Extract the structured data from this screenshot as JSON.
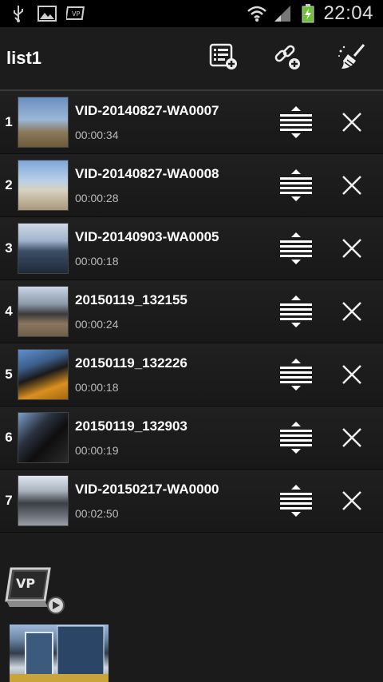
{
  "status_bar": {
    "time": "22:04",
    "icons": [
      "usb-icon",
      "image-icon",
      "vp-notification-icon",
      "wifi-icon",
      "signal-icon",
      "battery-charging-icon"
    ]
  },
  "header": {
    "title": "list1",
    "actions": [
      "add-list-icon",
      "add-link-icon",
      "clear-broom-icon"
    ]
  },
  "items": [
    {
      "index": "1",
      "name": "VID-20140827-WA0007",
      "duration": "00:00:34"
    },
    {
      "index": "2",
      "name": "VID-20140827-WA0008",
      "duration": "00:00:28"
    },
    {
      "index": "3",
      "name": "VID-20140903-WA0005",
      "duration": "00:00:18"
    },
    {
      "index": "4",
      "name": "20150119_132155",
      "duration": "00:00:24"
    },
    {
      "index": "5",
      "name": "20150119_132226",
      "duration": "00:00:18"
    },
    {
      "index": "6",
      "name": "20150119_132903",
      "duration": "00:00:19"
    },
    {
      "index": "7",
      "name": "VID-20150217-WA0000",
      "duration": "00:02:50"
    }
  ],
  "row_icons": {
    "move": "reorder-handle-icon",
    "delete": "close-icon"
  },
  "colors": {
    "background": "#1b1b1b",
    "status_bar": "#000000",
    "battery": "#6fbf3a"
  }
}
